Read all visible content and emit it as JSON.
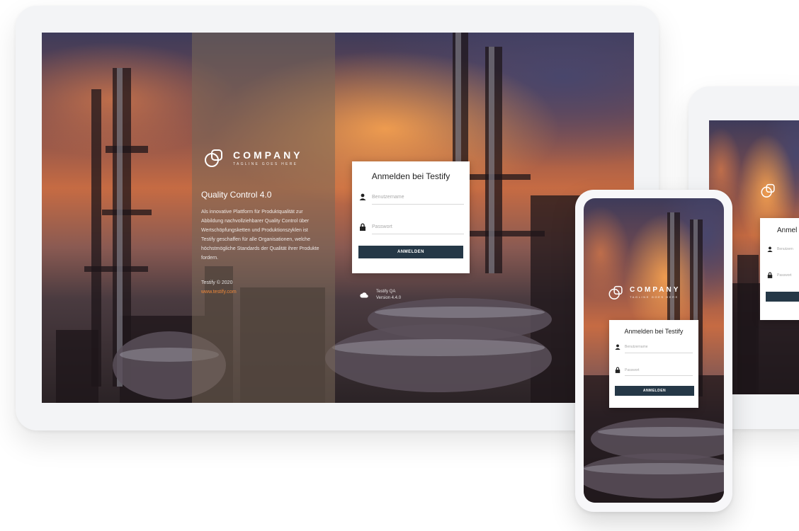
{
  "company": {
    "name": "COMPANY",
    "tagline": "TAGLINE GOES HERE"
  },
  "intro": {
    "title": "Quality Control 4.0",
    "description": "Als innovative Plattform für Produktqualität zur Abbildung nachvollziehbarer Quality Control über Wertschöpfungsketten und Produktionszyklen ist Testify geschaffen für alle Organisationen, welche höchstmögliche Standards der Qualität ihrer Produkte fordern.",
    "copyright": "Testify © 2020",
    "link": "www.testify.com"
  },
  "login": {
    "title": "Anmelden bei Testify",
    "username_placeholder": "Benutzername",
    "password_placeholder": "Passwort",
    "submit_label": "ANMELDEN",
    "title_cropped": "Anmel",
    "username_cropped": "Benutzern",
    "password_cropped": "Passwort"
  },
  "version": {
    "product": "Testify QA",
    "number": "Version 4.4.0"
  },
  "colors": {
    "button": "#253847",
    "accent_link": "#f0893a",
    "device_frame": "#f3f4f6"
  },
  "icons": [
    "logo-mark-icon",
    "user-icon",
    "lock-icon",
    "cloud-icon"
  ]
}
